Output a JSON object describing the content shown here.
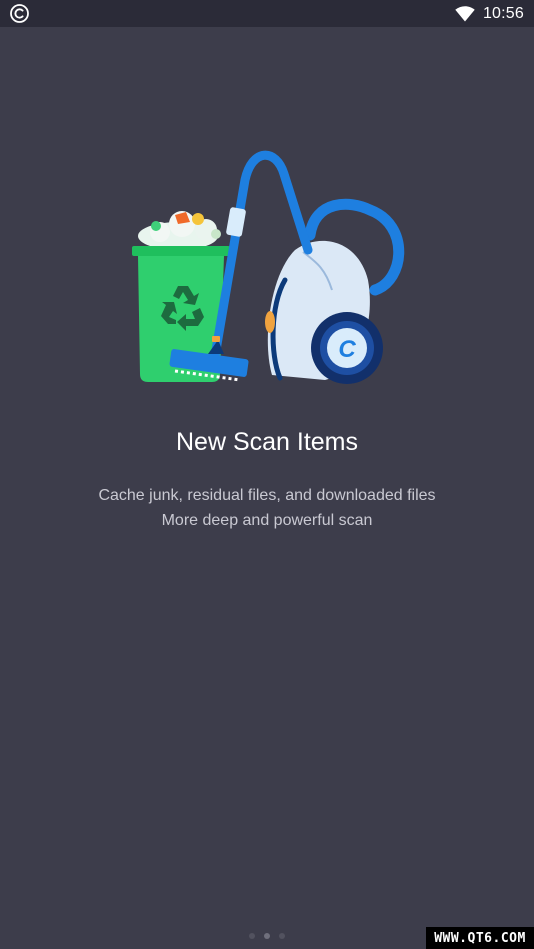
{
  "status_bar": {
    "app_icon": "copyright-c-icon",
    "wifi_icon": "wifi-icon",
    "time": "10:56"
  },
  "onboarding": {
    "illustration": "trash-bin-vacuum-illustration",
    "title": "New Scan Items",
    "description_line_1": "Cache junk, residual files, and downloaded files",
    "description_line_2": "More deep and powerful scan",
    "page_indicator": {
      "total": 3,
      "current": 2
    }
  },
  "watermark": {
    "text": "WWW.QT6.COM"
  },
  "colors": {
    "background": "#3d3d4b",
    "status_bar": "#2b2b38",
    "bin_green": "#2fcf6e",
    "vacuum_blue": "#1e7fe0"
  }
}
